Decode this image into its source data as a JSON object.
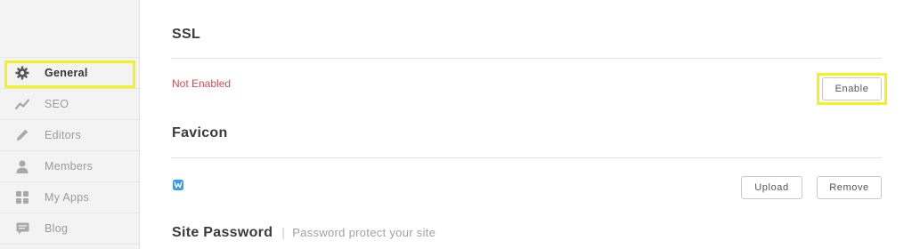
{
  "sidebar": {
    "items": [
      {
        "label": "General",
        "icon": "gear-icon",
        "active": true
      },
      {
        "label": "SEO",
        "icon": "trend-icon"
      },
      {
        "label": "Editors",
        "icon": "pencil-icon"
      },
      {
        "label": "Members",
        "icon": "user-icon"
      },
      {
        "label": "My Apps",
        "icon": "apps-grid-icon"
      },
      {
        "label": "Blog",
        "icon": "blog-icon"
      }
    ]
  },
  "ssl": {
    "title": "SSL",
    "status": "Not Enabled",
    "enable_label": "Enable"
  },
  "favicon": {
    "title": "Favicon",
    "icon": "weebly-favicon-icon",
    "upload_label": "Upload",
    "remove_label": "Remove"
  },
  "site_password": {
    "title": "Site Password",
    "subtitle": "Password protect your site"
  },
  "colors": {
    "highlight": "#f2f21c",
    "status_error": "#d0505a",
    "favicon_blue": "#3b9be5"
  }
}
